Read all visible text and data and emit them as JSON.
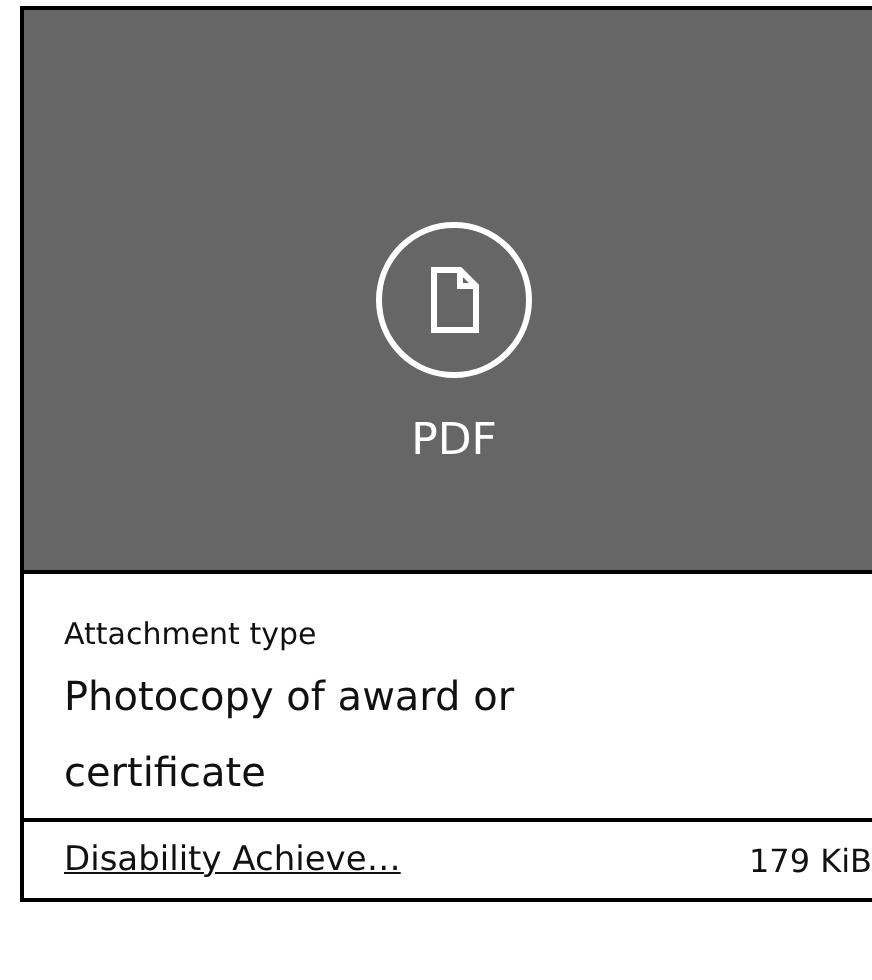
{
  "preview": {
    "file_type": "PDF"
  },
  "attachment_type": {
    "label": "Attachment type",
    "value": "Photocopy of award or certificate"
  },
  "file": {
    "name": "Disability Achieve…",
    "size": "179 KiB"
  }
}
